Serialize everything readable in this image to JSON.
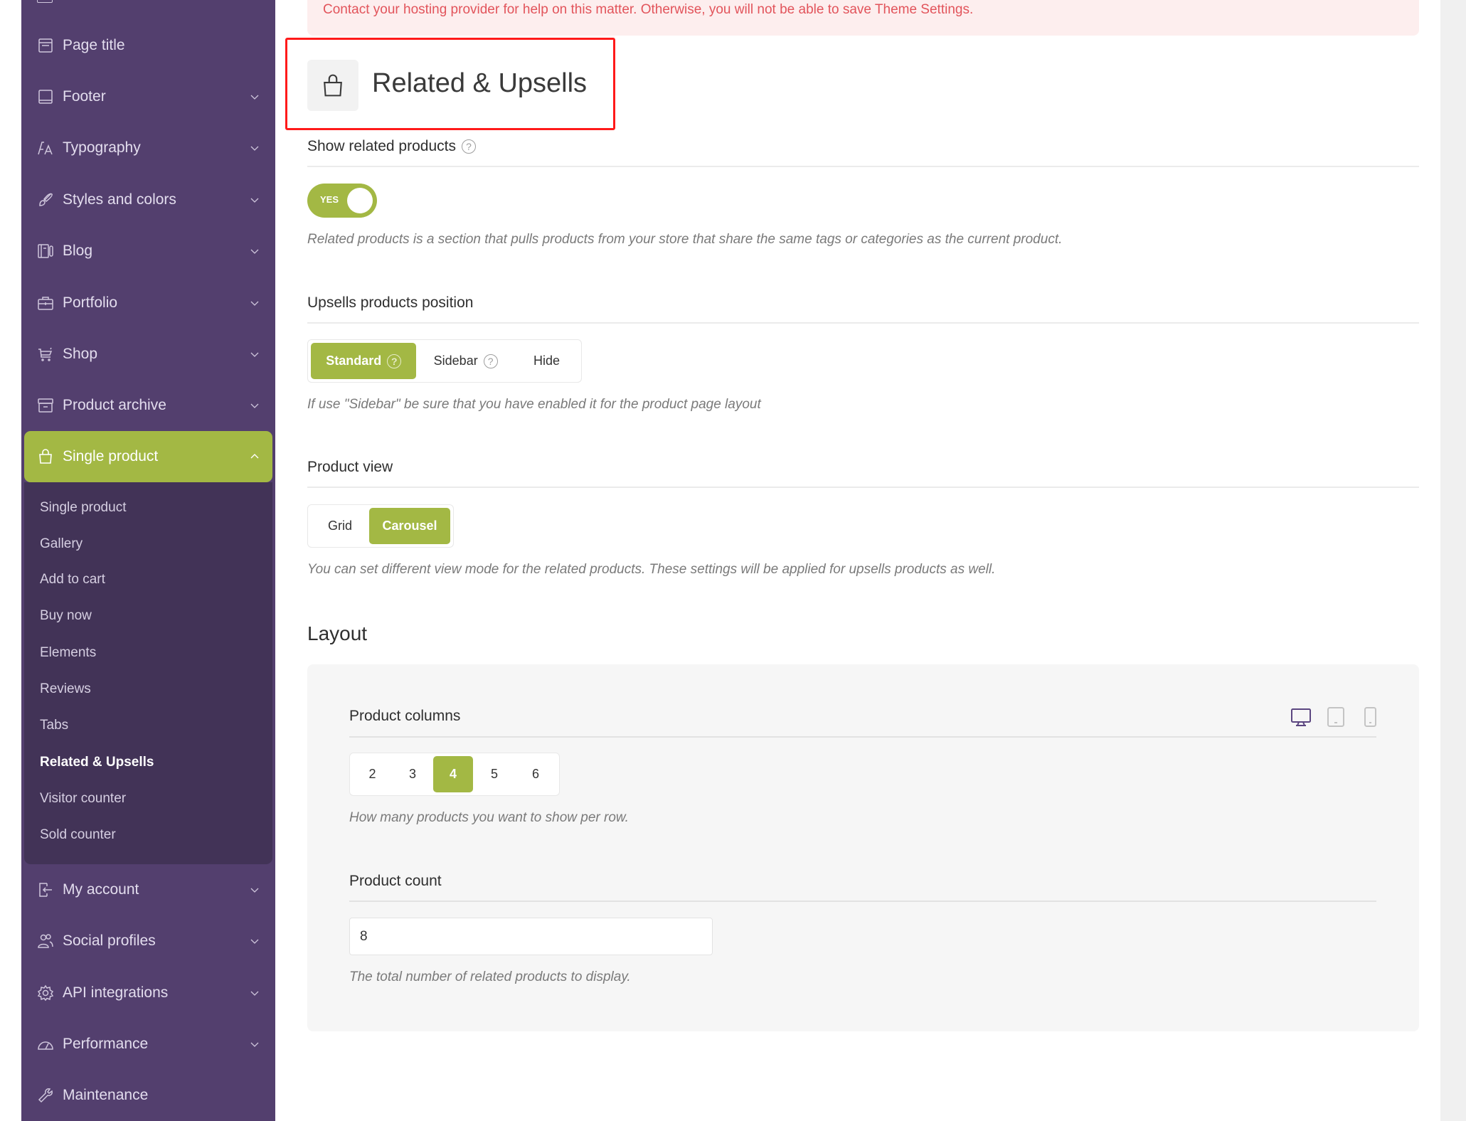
{
  "alert": {
    "message": "Contact your hosting provider for help on this matter. Otherwise, you will not be able to save Theme Settings."
  },
  "sidebar": {
    "items": [
      {
        "label": "Page title",
        "icon": "page-title-icon",
        "has_chevron": false
      },
      {
        "label": "Footer",
        "icon": "footer-icon",
        "has_chevron": true
      },
      {
        "label": "Typography",
        "icon": "typography-icon",
        "has_chevron": true
      },
      {
        "label": "Styles and colors",
        "icon": "brush-icon",
        "has_chevron": true
      },
      {
        "label": "Blog",
        "icon": "blog-icon",
        "has_chevron": true
      },
      {
        "label": "Portfolio",
        "icon": "briefcase-icon",
        "has_chevron": true
      },
      {
        "label": "Shop",
        "icon": "cart-icon",
        "has_chevron": true
      },
      {
        "label": "Product archive",
        "icon": "archive-icon",
        "has_chevron": true
      },
      {
        "label": "Single product",
        "icon": "shopping-bag-icon",
        "has_chevron": true,
        "active": true
      },
      {
        "label": "My account",
        "icon": "login-icon",
        "has_chevron": true
      },
      {
        "label": "Social profiles",
        "icon": "users-icon",
        "has_chevron": true
      },
      {
        "label": "API integrations",
        "icon": "gear-icon",
        "has_chevron": true
      },
      {
        "label": "Performance",
        "icon": "gauge-icon",
        "has_chevron": true
      },
      {
        "label": "Maintenance",
        "icon": "wrench-icon",
        "has_chevron": false
      }
    ],
    "submenu": [
      {
        "label": "Single product"
      },
      {
        "label": "Gallery"
      },
      {
        "label": "Add to cart"
      },
      {
        "label": "Buy now"
      },
      {
        "label": "Elements"
      },
      {
        "label": "Reviews"
      },
      {
        "label": "Tabs"
      },
      {
        "label": "Related & Upsells",
        "current": true
      },
      {
        "label": "Visitor counter"
      },
      {
        "label": "Sold counter"
      }
    ]
  },
  "page": {
    "title": "Related & Upsells",
    "title_icon": "shopping-bag-icon"
  },
  "show_related": {
    "label": "Show related products",
    "help": "?",
    "toggle_label": "YES",
    "enabled": true,
    "description": "Related products is a section that pulls products from your store that share the same tags or categories as the current product."
  },
  "upsells_position": {
    "label": "Upsells products position",
    "options": [
      {
        "label": "Standard",
        "help": "?",
        "selected": true
      },
      {
        "label": "Sidebar",
        "help": "?",
        "selected": false
      },
      {
        "label": "Hide",
        "selected": false
      }
    ],
    "description": "If use \"Sidebar\" be sure that you have enabled it for the product page layout"
  },
  "product_view": {
    "label": "Product view",
    "options": [
      {
        "label": "Grid",
        "selected": false
      },
      {
        "label": "Carousel",
        "selected": true
      }
    ],
    "description": "You can set different view mode for the related products. These settings will be applied for upsells products as well."
  },
  "layout": {
    "title": "Layout",
    "product_columns": {
      "label": "Product columns",
      "devices": [
        {
          "name": "desktop",
          "active": true
        },
        {
          "name": "tablet",
          "active": false
        },
        {
          "name": "mobile",
          "active": false
        }
      ],
      "options": [
        "2",
        "3",
        "4",
        "5",
        "6"
      ],
      "selected": "4",
      "description": "How many products you want to show per row."
    },
    "product_count": {
      "label": "Product count",
      "value": "8",
      "description": "The total number of related products to display."
    }
  },
  "colors": {
    "sidebar_bg": "#533f6e",
    "submenu_bg": "#423357",
    "accent": "#a3b844",
    "alert_bg": "#fdeeee",
    "alert_text": "#e2545b",
    "highlight_border": "#ff1a1a"
  }
}
